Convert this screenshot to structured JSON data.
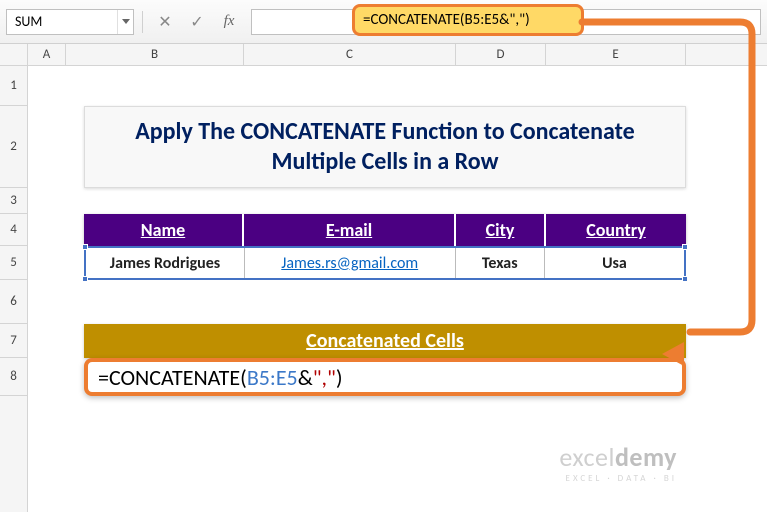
{
  "toolbar": {
    "namebox_value": "SUM",
    "cancel_icon": "✕",
    "enter_icon": "✓",
    "fx_label": "fx",
    "formula_text": "=CONCATENATE(B5:E5&\",\")"
  },
  "columns": {
    "A": "A",
    "B": "B",
    "C": "C",
    "D": "D",
    "E": "E"
  },
  "rows": [
    "1",
    "2",
    "3",
    "4",
    "5",
    "6",
    "7",
    "8"
  ],
  "title": "Apply The CONCATENATE Function to Concatenate Multiple Cells in a Row",
  "table": {
    "headers": {
      "name": "Name",
      "email": "E-mail",
      "city": "City",
      "country": "Country"
    },
    "row": {
      "name": "James Rodrigues",
      "email": "James.rs@gmail.com",
      "city": "Texas",
      "country": "Usa"
    }
  },
  "concat_header": "Concatenated Cells",
  "edit_formula": {
    "prefix": "=CONCATENATE(",
    "ref": "B5:E5",
    "amp": "&",
    "str": "\",\"",
    "suffix": ")"
  },
  "watermark": {
    "brand_a": "excel",
    "brand_b": "demy",
    "tagline": "EXCEL · DATA · BI"
  },
  "colors": {
    "accent": "#ed7d31",
    "purple": "#4b0082",
    "gold": "#bf8f00",
    "navy": "#002060"
  }
}
